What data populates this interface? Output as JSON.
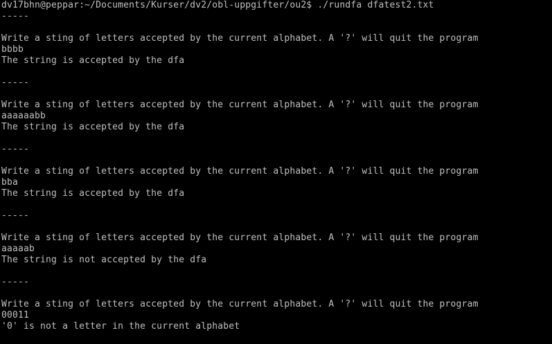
{
  "terminal": {
    "background": "#000000",
    "foreground": "#c0c0c0",
    "lines": [
      "dv17bhn@peppar:~/Documents/Kurser/dv2/obl-uppgifter/ou2$ ./rundfa dfatest2.txt",
      "-----",
      "",
      "Write a sting of letters accepted by the current alphabet. A '?' will quit the program",
      "bbbb",
      "The string is accepted by the dfa",
      "",
      "-----",
      "",
      "Write a sting of letters accepted by the current alphabet. A '?' will quit the program",
      "aaaaaabb",
      "The string is accepted by the dfa",
      "",
      "-----",
      "",
      "Write a sting of letters accepted by the current alphabet. A '?' will quit the program",
      "bba",
      "The string is accepted by the dfa",
      "",
      "-----",
      "",
      "Write a sting of letters accepted by the current alphabet. A '?' will quit the program",
      "aaaaab",
      "The string is not accepted by the dfa",
      "",
      "-----",
      "",
      "Write a sting of letters accepted by the current alphabet. A '?' will quit the program",
      "00011",
      "'0' is not a letter in the current alphabet"
    ]
  }
}
